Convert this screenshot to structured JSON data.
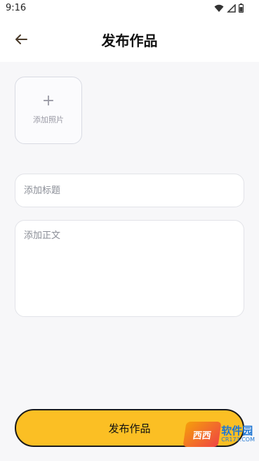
{
  "status_bar": {
    "time": "9:16",
    "icons": [
      "wifi-icon",
      "signal-icon",
      "battery-icon"
    ]
  },
  "header": {
    "back_icon": "arrow-left-icon",
    "title": "发布作品"
  },
  "photo": {
    "icon": "plus-icon",
    "label": "添加照片"
  },
  "form": {
    "title_placeholder": "添加标题",
    "body_placeholder": "添加正文"
  },
  "actions": {
    "publish_label": "发布作品"
  },
  "colors": {
    "accent": "#fbbf24",
    "background": "#f7f7f9"
  },
  "watermark": {
    "logo_text": "西西",
    "name": "软件园",
    "url": "CR173.COM"
  }
}
